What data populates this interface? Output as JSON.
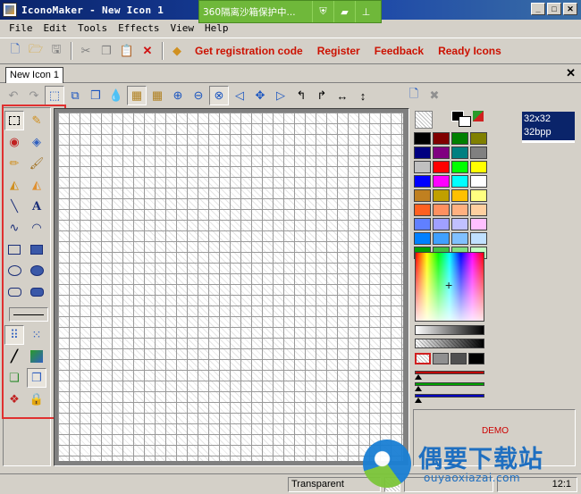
{
  "window": {
    "title": "IconoMaker - New Icon 1",
    "sandbox_banner": "360隔离沙箱保护中...",
    "controls": [
      "_",
      "□",
      "✕"
    ]
  },
  "menu": [
    "File",
    "Edit",
    "Tools",
    "Effects",
    "View",
    "Help"
  ],
  "toolbar": {
    "links": [
      "Get registration code",
      "Register",
      "Feedback",
      "Ready Icons"
    ]
  },
  "document_tabs": [
    {
      "label": "New Icon 1"
    }
  ],
  "tab_close": "✕",
  "text_tool_glyph": "A",
  "palette": {
    "swatches": [
      "#000000",
      "#800000",
      "#008000",
      "#808000",
      "#000080",
      "#800080",
      "#008080",
      "#808080",
      "#c0c0c0",
      "#ff0000",
      "#00ff00",
      "#ffff00",
      "#0000ff",
      "#ff00ff",
      "#00ffff",
      "#ffffff",
      "#c08020",
      "#c0a000",
      "#ffc000",
      "#ffff80",
      "#ff6020",
      "#ff9060",
      "#ffb080",
      "#ffd0a0",
      "#6080ff",
      "#a0a0ff",
      "#c0c0ff",
      "#ffc0ff",
      "#0080ff",
      "#40a0ff",
      "#80c0ff",
      "#c0e0ff",
      "#00a000",
      "#40c040",
      "#80e080",
      "#c0ffc0"
    ],
    "channel_colors": [
      "#c00000",
      "#00a000",
      "#0000c0"
    ]
  },
  "formats": [
    {
      "label": "32x32"
    },
    {
      "label": "32bpp"
    }
  ],
  "demo_label": "DEMO",
  "status": {
    "color": "Transparent",
    "coords": "12:1"
  },
  "watermark": {
    "cn": "偶要下载站",
    "url": "ouyaoxiazai.com"
  }
}
